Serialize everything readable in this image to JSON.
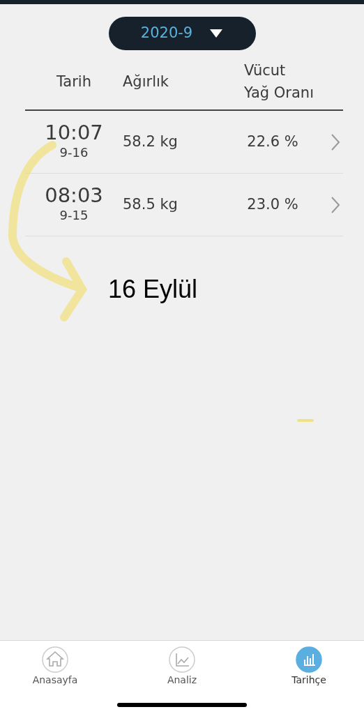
{
  "month_picker": {
    "value": "2020-9"
  },
  "table": {
    "columns": [
      "Tarih",
      "Ağırlık",
      "Vücut\nYağ Oranı"
    ],
    "rows": [
      {
        "time": "10:07",
        "date": "9-16",
        "weight": "58.2 kg",
        "body_fat": "22.6 %"
      },
      {
        "time": "08:03",
        "date": "9-15",
        "weight": "58.5 kg",
        "body_fat": "23.0 %"
      }
    ]
  },
  "annotation": {
    "text": "16 Eylül"
  },
  "tab_bar": [
    {
      "label": "Anasayfa",
      "selected": false
    },
    {
      "label": "Analiz",
      "selected": false
    },
    {
      "label": "Tarihçe",
      "selected": true
    }
  ]
}
